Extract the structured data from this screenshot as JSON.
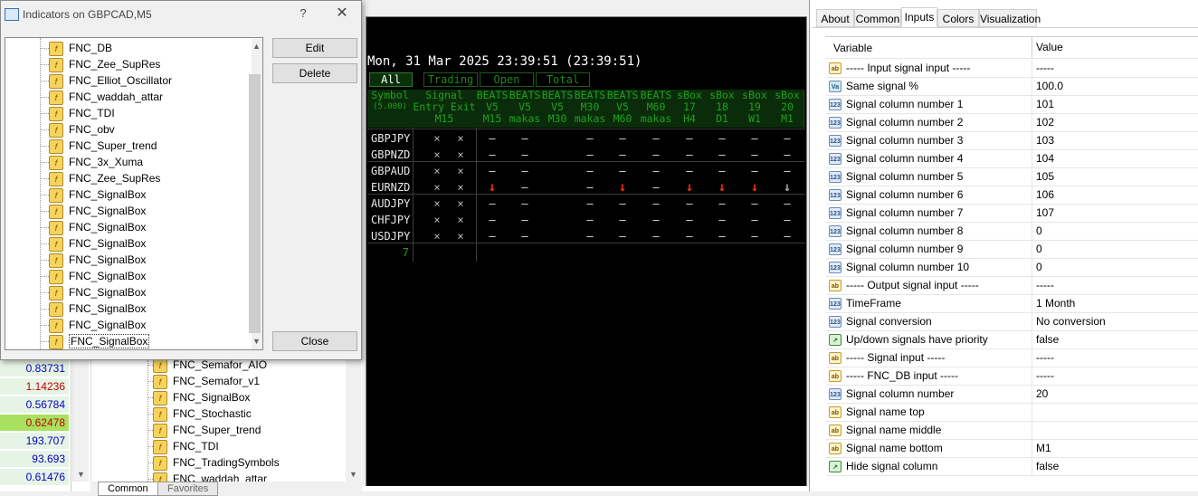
{
  "dialog": {
    "title": "Indicators on GBPCAD,M5",
    "help": "?",
    "close": "✕",
    "buttons": {
      "edit": "Edit",
      "delete": "Delete",
      "close": "Close"
    },
    "tree_items": [
      "FNC_DB",
      "FNC_Zee_SupRes",
      "FNC_Elliot_Oscillator",
      "FNC_waddah_attar",
      "FNC_TDI",
      "FNC_obv",
      "FNC_Super_trend",
      "FNC_3x_Xuma",
      "FNC_Zee_SupRes",
      "FNC_SignalBox",
      "FNC_SignalBox",
      "FNC_SignalBox",
      "FNC_SignalBox",
      "FNC_SignalBox",
      "FNC_SignalBox",
      "FNC_SignalBox",
      "FNC_SignalBox",
      "FNC_SignalBox",
      "FNC_SignalBox"
    ],
    "selected_index": 18
  },
  "background": {
    "prices": [
      {
        "value": "0.83731",
        "color": "#0000c0",
        "bg": "#e6f4e6"
      },
      {
        "value": "1.14236",
        "color": "#c00000",
        "bg": "#e6f4e6"
      },
      {
        "value": "0.56784",
        "color": "#0000c0",
        "bg": "#e6f4e6"
      },
      {
        "value": "0.62478",
        "color": "#c00000",
        "bg": "#a8e060"
      },
      {
        "value": "193.707",
        "color": "#0000c0",
        "bg": "#e6f4e6"
      },
      {
        "value": "93.693",
        "color": "#0000c0",
        "bg": "#e6f4e6"
      },
      {
        "value": "0.61476",
        "color": "#0000c0",
        "bg": "#e6f4e6"
      }
    ],
    "navigator_items": [
      "FNC_Semafor_AIO",
      "FNC_Semafor_v1",
      "FNC_SignalBox",
      "FNC_Stochastic",
      "FNC_Super_trend",
      "FNC_TDI",
      "FNC_TradingSymbols",
      "FNC_waddah_attar"
    ],
    "bottom_tabs": [
      "Common",
      "Favorites"
    ]
  },
  "chart": {
    "datetime": "Mon, 31 Mar 2025 23:39:51 (23:39:51)",
    "filter_tabs": [
      "All",
      "Trading",
      "Open",
      "Total"
    ],
    "active_filter": 0,
    "headers": [
      [
        "Symbol",
        "(5.000)"
      ],
      [
        "Signal",
        "Entry Exit",
        "M15"
      ],
      [
        "BEATS",
        "V5",
        "M15"
      ],
      [
        "BEATS",
        "V5",
        "makas"
      ],
      [
        "BEATS",
        "V5",
        "M30"
      ],
      [
        "BEATS",
        "M30",
        "makas"
      ],
      [
        "BEATS",
        "V5",
        "M60"
      ],
      [
        "BEATS",
        "M60",
        "makas"
      ],
      [
        "sBox",
        "17",
        "H4"
      ],
      [
        "sBox",
        "18",
        "D1"
      ],
      [
        "sBox",
        "19",
        "W1"
      ],
      [
        "sBox",
        "20",
        "M1"
      ]
    ],
    "rows": [
      {
        "symbol": "GBPJPY",
        "cells": [
          "×",
          "×",
          "–",
          "–",
          "",
          "–",
          "–",
          "–",
          "–",
          "–",
          "–",
          "–"
        ]
      },
      {
        "symbol": "GBPNZD",
        "cells": [
          "×",
          "×",
          "–",
          "–",
          "",
          "–",
          "–",
          "–",
          "–",
          "–",
          "–",
          "–"
        ]
      },
      {
        "symbol": "GBPAUD",
        "cells": [
          "×",
          "×",
          "–",
          "–",
          "",
          "–",
          "–",
          "–",
          "–",
          "–",
          "–",
          "–"
        ]
      },
      {
        "symbol": "EURNZD",
        "cells": [
          "×",
          "×",
          "↓",
          "–",
          "",
          "–",
          "↓",
          "–",
          "↓",
          "↓",
          "↓",
          "↓"
        ]
      },
      {
        "symbol": "AUDJPY",
        "cells": [
          "×",
          "×",
          "–",
          "–",
          "",
          "–",
          "–",
          "–",
          "–",
          "–",
          "–",
          "–"
        ]
      },
      {
        "symbol": "CHFJPY",
        "cells": [
          "×",
          "×",
          "–",
          "–",
          "",
          "–",
          "–",
          "–",
          "–",
          "–",
          "–",
          "–"
        ]
      },
      {
        "symbol": "USDJPY",
        "cells": [
          "×",
          "×",
          "–",
          "–",
          "",
          "–",
          "–",
          "–",
          "–",
          "–",
          "–",
          "–"
        ]
      }
    ],
    "count": "7",
    "colors": {
      "down_signal": "#ff3300",
      "down_neutral": "#aaaaaa",
      "header_text": "#1fa11f"
    }
  },
  "properties": {
    "tabs": [
      "About",
      "Common",
      "Inputs",
      "Colors",
      "Visualization"
    ],
    "active_tab": 2,
    "columns": {
      "variable": "Variable",
      "value": "Value"
    },
    "rows": [
      {
        "icon": "ab",
        "name": "----- Input signal input -----",
        "value": "-----"
      },
      {
        "icon": "dbl",
        "name": "Same signal %",
        "value": "100.0"
      },
      {
        "icon": "int",
        "name": "Signal column number 1",
        "value": "101"
      },
      {
        "icon": "int",
        "name": "Signal column number 2",
        "value": "102"
      },
      {
        "icon": "int",
        "name": "Signal column number 3",
        "value": "103"
      },
      {
        "icon": "int",
        "name": "Signal column number 4",
        "value": "104"
      },
      {
        "icon": "int",
        "name": "Signal column number 5",
        "value": "105"
      },
      {
        "icon": "int",
        "name": "Signal column number 6",
        "value": "106"
      },
      {
        "icon": "int",
        "name": "Signal column number 7",
        "value": "107"
      },
      {
        "icon": "int",
        "name": "Signal column number 8",
        "value": "0"
      },
      {
        "icon": "int",
        "name": "Signal column number 9",
        "value": "0"
      },
      {
        "icon": "int",
        "name": "Signal column number 10",
        "value": "0"
      },
      {
        "icon": "ab",
        "name": "----- Output signal input -----",
        "value": "-----"
      },
      {
        "icon": "int",
        "name": "TimeFrame",
        "value": "1 Month"
      },
      {
        "icon": "int",
        "name": "Signal conversion",
        "value": "No conversion"
      },
      {
        "icon": "bool",
        "name": "Up/down signals have priority",
        "value": "false"
      },
      {
        "icon": "ab",
        "name": "----- Signal input -----",
        "value": "-----"
      },
      {
        "icon": "ab",
        "name": "----- FNC_DB input -----",
        "value": "-----"
      },
      {
        "icon": "int",
        "name": "Signal column number",
        "value": "20"
      },
      {
        "icon": "ab",
        "name": "Signal name top",
        "value": ""
      },
      {
        "icon": "ab",
        "name": "Signal name middle",
        "value": ""
      },
      {
        "icon": "ab",
        "name": "Signal name bottom",
        "value": "M1"
      },
      {
        "icon": "bool",
        "name": "Hide signal column",
        "value": "false"
      }
    ],
    "icon_labels": {
      "ab": "ab",
      "int": "123",
      "dbl": "Va",
      "bool": "↗"
    }
  }
}
